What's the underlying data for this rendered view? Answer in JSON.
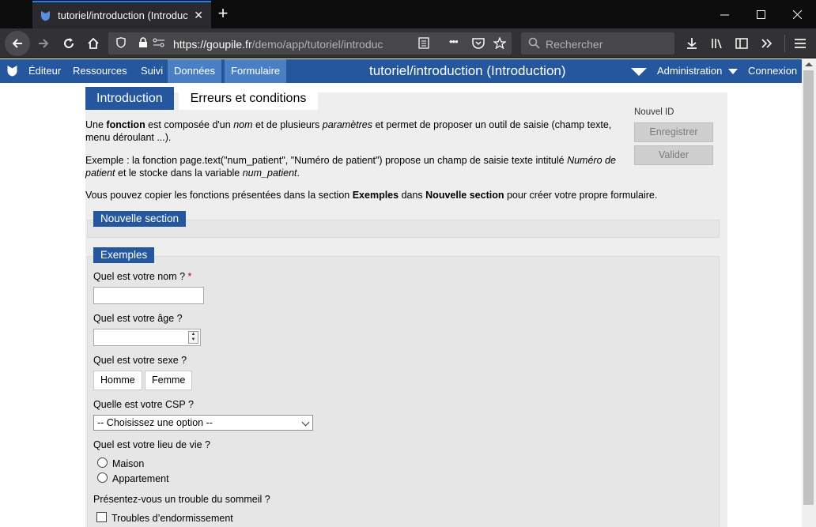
{
  "browser": {
    "tab_title": "tutoriel/introduction (Introduct",
    "url_host": "https://goupile.fr",
    "url_path": "/demo/app/tutoriel/introduc",
    "search_placeholder": "Rechercher",
    "menu_dots": "•••"
  },
  "appbar": {
    "items": [
      "Éditeur",
      "Ressources",
      "Suivi",
      "Données",
      "Formulaire"
    ],
    "title": "tutoriel/introduction (Introduction)",
    "admin": "Administration",
    "login": "Connexion"
  },
  "page": {
    "tabs": [
      "Introduction",
      "Erreurs et conditions"
    ],
    "intro": {
      "p1_a": "Une ",
      "p1_b": "fonction",
      "p1_c": " est composée d'un ",
      "p1_d": "nom",
      "p1_e": " et de plusieurs ",
      "p1_f": "paramètres",
      "p1_g": " et permet de proposer un outil de saisie (champ texte, menu déroulant ...).",
      "p2_a": "Exemple : la fonction page.text(\"num_patient\", \"Numéro de patient\") propose un champ de saisie texte intitulé ",
      "p2_b": "Numéro de patient",
      "p2_c": " et le stocke dans la variable ",
      "p2_d": "num_patient",
      "p2_e": ".",
      "p3_a": "Vous pouvez copier les fonctions présentées dans la section ",
      "p3_b": "Exemples",
      "p3_c": " dans ",
      "p3_d": "Nouvelle section",
      "p3_e": " pour créer votre propre formulaire."
    },
    "side": {
      "new_id": "Nouvel ID",
      "save": "Enregistrer",
      "validate": "Valider"
    },
    "sections": {
      "new": "Nouvelle section",
      "examples": "Exemples"
    },
    "questions": {
      "name": "Quel est votre nom ?",
      "required_mark": "*",
      "age": "Quel est votre âge ?",
      "sex": "Quel est votre sexe ?",
      "sex_options": [
        "Homme",
        "Femme"
      ],
      "csp": "Quelle est votre CSP ?",
      "csp_selected": "-- Choisissez une option --",
      "living": "Quel est votre lieu de vie ?",
      "living_options": [
        "Maison",
        "Appartement"
      ],
      "sleep": "Présentez-vous un trouble du sommeil ?",
      "sleep_options": [
        "Troubles d’endormissement"
      ]
    }
  }
}
